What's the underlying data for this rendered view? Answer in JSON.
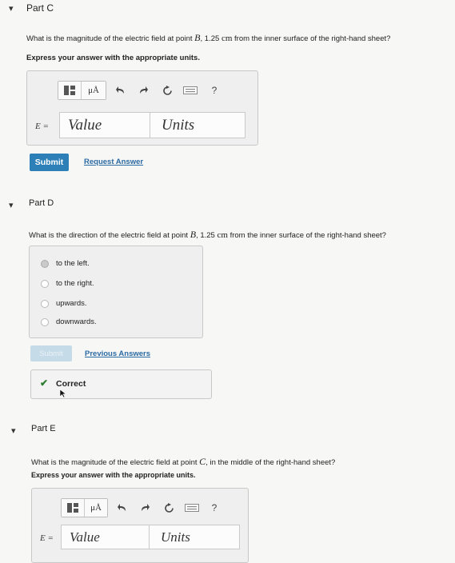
{
  "partC": {
    "title": "Part C",
    "q_prefix": "What is the magnitude of the electric field at point ",
    "q_point": "B",
    "q_mid": ", 1.25 ",
    "q_unit": "cm",
    "q_suffix": " from the inner surface of the right-hand sheet?",
    "instructions": "Express your answer with the appropriate units.",
    "var_label": "E =",
    "value_placeholder": "Value",
    "units_placeholder": "Units",
    "submit_label": "Submit",
    "request_label": "Request Answer",
    "toolbar": {
      "mu_label": "μÅ",
      "help_label": "?"
    }
  },
  "partD": {
    "title": "Part D",
    "q_prefix": "What is the direction of the electric field at point ",
    "q_point": "B",
    "q_mid": ", 1.25 ",
    "q_unit": "cm",
    "q_suffix": " from the inner surface of the right-hand sheet?",
    "choices": [
      "to the left.",
      "to the right.",
      "upwards.",
      "downwards."
    ],
    "selected_index": 0,
    "submit_label": "Submit",
    "previous_label": "Previous Answers",
    "feedback_label": "Correct"
  },
  "partE": {
    "title": "Part E",
    "q_prefix": "What is the magnitude of the electric field at point ",
    "q_point": "C",
    "q_suffix": ", in the middle of the right-hand sheet?",
    "instructions": "Express your answer with the appropriate units.",
    "var_label": "E =",
    "value_placeholder": "Value",
    "units_placeholder": "Units",
    "toolbar": {
      "mu_label": "μÅ",
      "help_label": "?"
    }
  },
  "colors": {
    "primary_button": "#2d7fb8",
    "link": "#2b6aa2",
    "correct_check": "#2e7d32"
  }
}
